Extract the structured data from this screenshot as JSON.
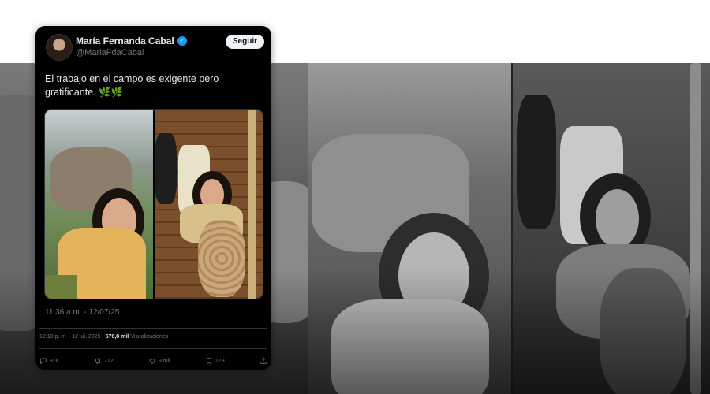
{
  "tweet": {
    "author_name": "María Fernanda Cabal",
    "handle": "@MariaFdaCabal",
    "follow_label": "Seguir",
    "text": "El trabajo en el campo es exigente pero gratificante.",
    "emojis": "🌿🌿",
    "photo_timestamp": "11:36 a.m. - 12/07/25",
    "meta": {
      "posted": "12:10 p. m. · 12 jul. 2025 ·",
      "views_count": "676,8 mil",
      "views_label": "Visualizaciones"
    },
    "actions": {
      "replies": "316",
      "retweets": "712",
      "likes": "9 mil",
      "bookmarks": "179"
    }
  },
  "colors": {
    "verified": "#1d9bf0",
    "card_bg": "#000000",
    "muted_text": "#71767b"
  },
  "icons": [
    "verified-icon",
    "reply-icon",
    "retweet-icon",
    "like-icon",
    "bookmark-icon",
    "share-icon"
  ]
}
